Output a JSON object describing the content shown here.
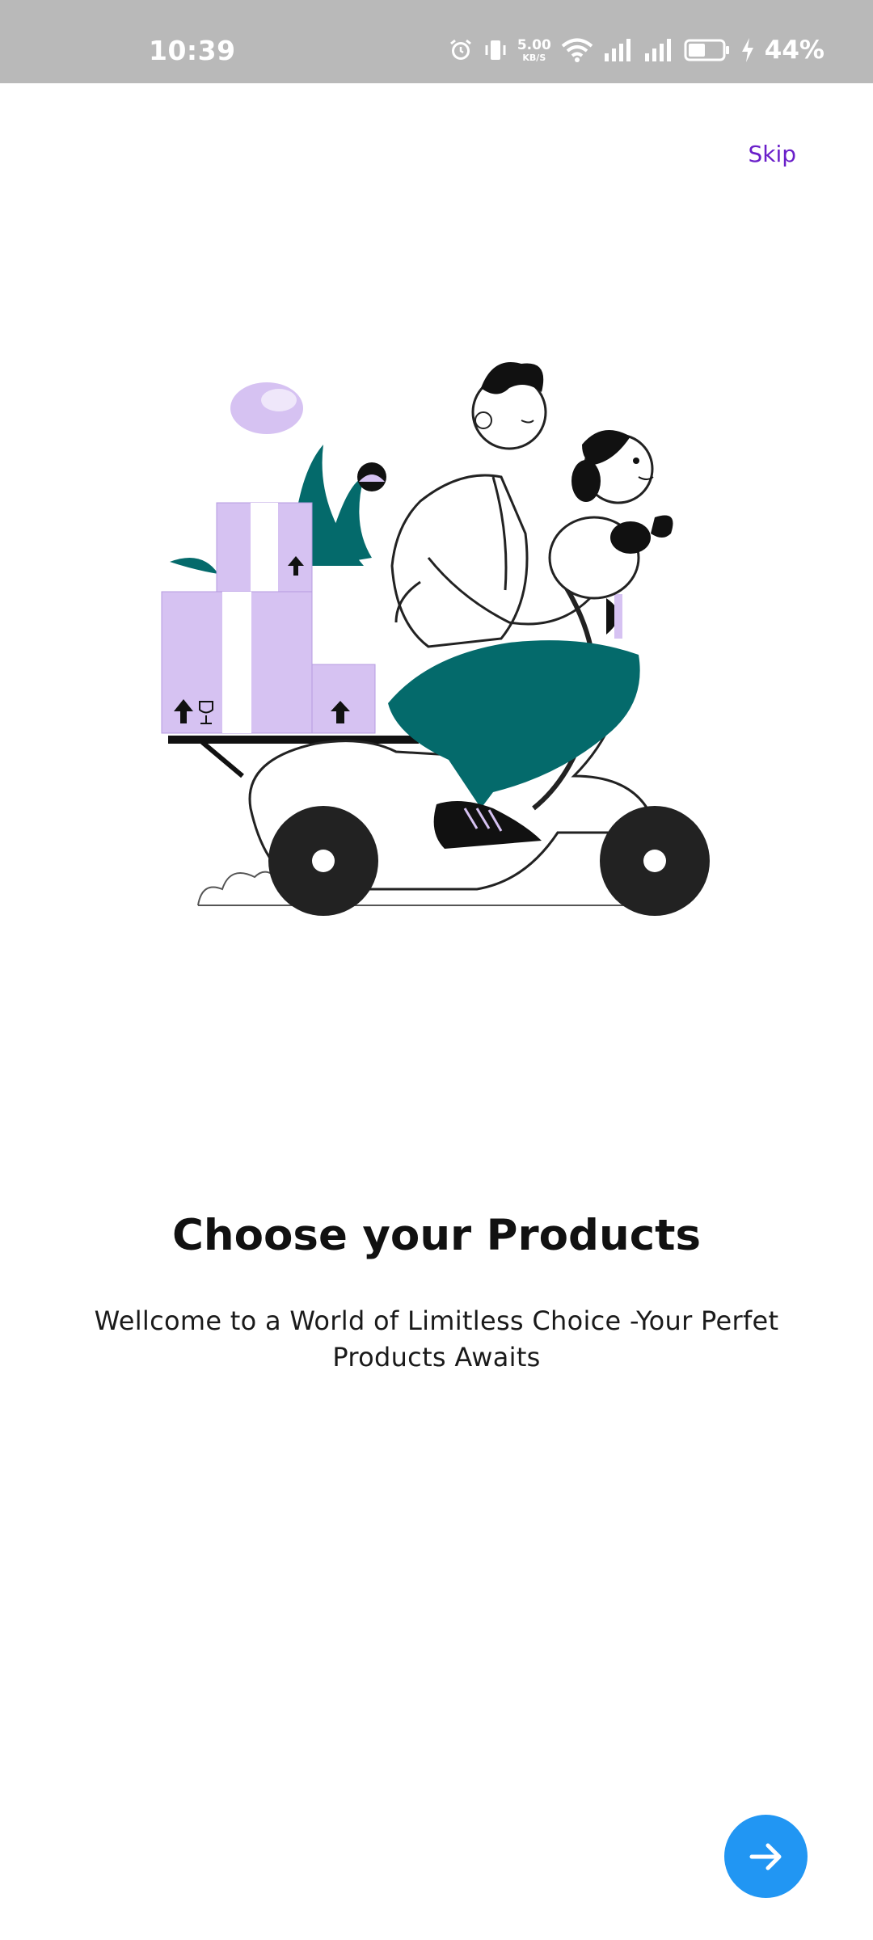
{
  "status_bar": {
    "time": "10:39",
    "net_speed_value": "5.00",
    "net_speed_unit": "KB/S",
    "battery_percent": "44%"
  },
  "onboarding": {
    "skip_label": "Skip",
    "title": "Choose your Products",
    "subtitle": "Wellcome to a World of Limitless Choice -Your Perfet Products Awaits",
    "next_icon": "arrow-right-icon"
  },
  "colors": {
    "accent": "#2196f3",
    "skip": "#6a1fc9",
    "illustration_box": "#d6c2f2",
    "illustration_pants": "#046a6b"
  }
}
